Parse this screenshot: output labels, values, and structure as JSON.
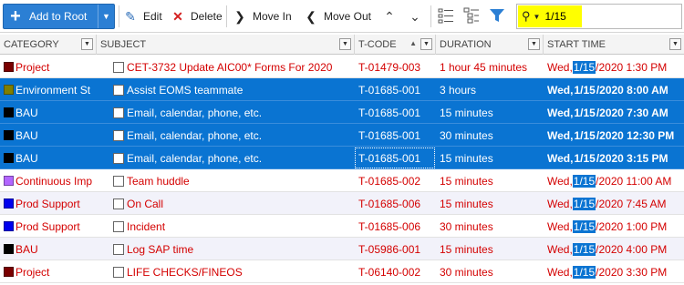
{
  "toolbar": {
    "add_label": "Add to Root",
    "edit_label": "Edit",
    "delete_label": "Delete",
    "move_in_label": "Move In",
    "move_out_label": "Move Out",
    "search_query": "1/15",
    "search_highlight_color": "#ffff00"
  },
  "columns": [
    "CATEGORY",
    "SUBJECT",
    "T-CODE",
    "DURATION",
    "START TIME"
  ],
  "colors": {
    "selection": "#0a74d2",
    "text_red": "#d40000",
    "add_button": "#2b7fd4"
  },
  "rows": [
    {
      "category": "Project",
      "swatch": "#7a0000",
      "subject": "CET-3732 Update AIC00* Forms For 2020",
      "tcode": "T-01479-003",
      "duration": "1 hour 45 minutes",
      "start_pre": "Wed, ",
      "start_hl": "1/15",
      "start_post": "/2020 1:30 PM"
    },
    {
      "category": "Environment St",
      "swatch": "#7f7f00",
      "subject": "Assist EOMS teammate",
      "tcode": "T-01685-001",
      "duration": "3 hours",
      "start_pre": "Wed, ",
      "start_hl": "1/15",
      "start_post": "/2020 8:00 AM"
    },
    {
      "category": "BAU",
      "swatch": "#000000",
      "subject": "Email, calendar, phone, etc.",
      "tcode": "T-01685-001",
      "duration": "15 minutes",
      "start_pre": "Wed, ",
      "start_hl": "1/15",
      "start_post": "/2020 7:30 AM"
    },
    {
      "category": "BAU",
      "swatch": "#000000",
      "subject": "Email, calendar, phone, etc.",
      "tcode": "T-01685-001",
      "duration": "30 minutes",
      "start_pre": "Wed, ",
      "start_hl": "1/15",
      "start_post": "/2020 12:30 PM"
    },
    {
      "category": "BAU",
      "swatch": "#000000",
      "subject": "Email, calendar, phone, etc.",
      "tcode": "T-01685-001",
      "duration": "15 minutes",
      "start_pre": "Wed, ",
      "start_hl": "1/15",
      "start_post": "/2020 3:15 PM"
    },
    {
      "category": "Continuous Imp",
      "swatch": "#b266ff",
      "subject": "Team huddle",
      "tcode": "T-01685-002",
      "duration": "15 minutes",
      "start_pre": "Wed, ",
      "start_hl": "1/15",
      "start_post": "/2020 11:00 AM"
    },
    {
      "category": "Prod Support",
      "swatch": "#0000ee",
      "subject": "On Call",
      "tcode": "T-01685-006",
      "duration": "15 minutes",
      "start_pre": "Wed, ",
      "start_hl": "1/15",
      "start_post": "/2020 7:45 AM"
    },
    {
      "category": "Prod Support",
      "swatch": "#0000ee",
      "subject": "Incident",
      "tcode": "T-01685-006",
      "duration": "30 minutes",
      "start_pre": "Wed, ",
      "start_hl": "1/15",
      "start_post": "/2020 1:00 PM"
    },
    {
      "category": "BAU",
      "swatch": "#000000",
      "subject": "Log SAP time",
      "tcode": "T-05986-001",
      "duration": "15 minutes",
      "start_pre": "Wed, ",
      "start_hl": "1/15",
      "start_post": "/2020 4:00 PM"
    },
    {
      "category": "Project",
      "swatch": "#7a0000",
      "subject": "LIFE CHECKS/FINEOS",
      "tcode": "T-06140-002",
      "duration": "30 minutes",
      "start_pre": "Wed, ",
      "start_hl": "1/15",
      "start_post": "/2020 3:30 PM"
    }
  ]
}
